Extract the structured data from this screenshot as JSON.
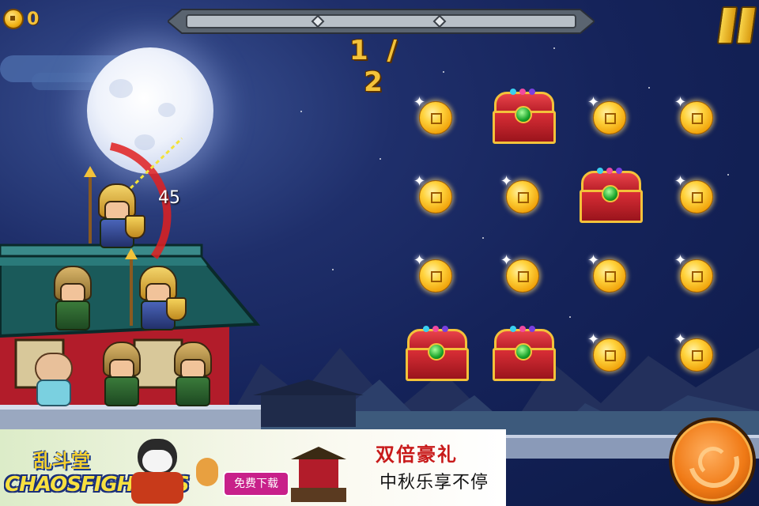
{
  "hud": {
    "wave_counter": "1 / 2",
    "coin_count": "0",
    "level_progress": 0
  },
  "aim": {
    "angle": "45"
  },
  "field": {
    "collectibles": [
      [
        "coin",
        "chest",
        "coin",
        "coin"
      ],
      [
        "coin",
        "coin",
        "chest",
        "coin"
      ],
      [
        "coin",
        "coin",
        "coin",
        "coin"
      ],
      [
        "chest",
        "chest",
        "coin",
        "coin"
      ]
    ]
  },
  "ad": {
    "logo_cn": "乱斗堂",
    "logo_en": "CHAOSFIGHTERS",
    "download_label": "免费下载",
    "headline": "双倍豪礼",
    "subline": "中秋乐享不停"
  },
  "icons": {
    "pause": "pause-icon",
    "coin": "coin-icon",
    "chest": "treasure-chest-icon",
    "skill": "skill-swirl-icon"
  },
  "colors": {
    "hud_gold": "#f3c23a",
    "sky_dark": "#0d1a48",
    "skill_orange": "#f07a16",
    "ad_magenta": "#c8208a"
  }
}
